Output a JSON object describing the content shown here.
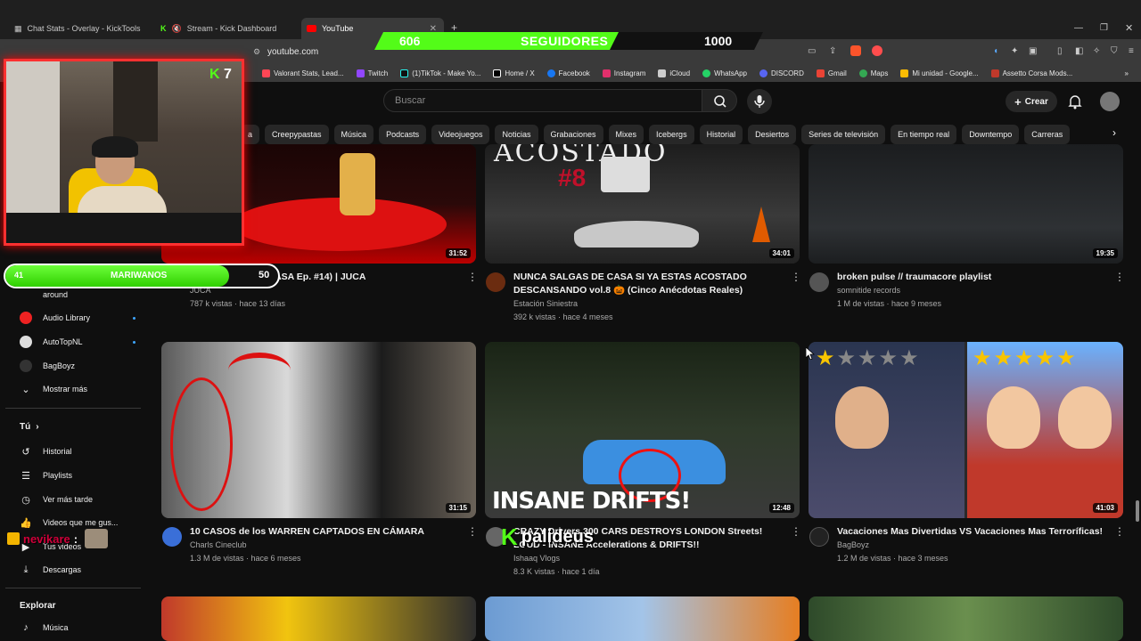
{
  "browser": {
    "tabs": [
      {
        "title": "Chat Stats - Overlay - KickTools",
        "active": false
      },
      {
        "title": "Stream - Kick Dashboard",
        "active": false
      },
      {
        "title": "YouTube",
        "active": true
      }
    ],
    "url": "youtube.com",
    "bookmarks": [
      "Valorant Stats, Lead...",
      "Twitch",
      "(1)TikTok - Make Yo...",
      "Home / X",
      "Facebook",
      "Instagram",
      "iCloud",
      "WhatsApp",
      "DISCORD",
      "Gmail",
      "Maps",
      "Mi unidad - Google...",
      "Assetto Corsa Mods..."
    ]
  },
  "youtube": {
    "search_placeholder": "Buscar",
    "create_label": "Crear",
    "chips": [
      "a",
      "Creepypastas",
      "Música",
      "Podcasts",
      "Videojuegos",
      "Noticias",
      "Grabaciones",
      "Mixes",
      "Icebergs",
      "Historial",
      "Desiertos",
      "Series de televisión",
      "En tiempo real",
      "Downtempo",
      "Carreras"
    ]
  },
  "sidebar": {
    "subscriptions": [
      {
        "label": "around",
        "dot": false
      },
      {
        "label": "Audio Library",
        "dot": true
      },
      {
        "label": "AutoTopNL",
        "dot": true
      },
      {
        "label": "BagBoyz",
        "dot": false
      }
    ],
    "show_more": "Mostrar más",
    "you_header": "Tú",
    "you_items": [
      "Historial",
      "Playlists",
      "Ver más tarde",
      "Videos que me gus...",
      "Tus videos",
      "Descargas"
    ],
    "explore_header": "Explorar",
    "explore_items": [
      "Música"
    ]
  },
  "videos_row1": [
    {
      "title": "...EGÓ A ...SA (JUCASA Ep. #14) | JUCA",
      "channel": "JUCA",
      "meta": "787 k vistas · hace 13 días",
      "duration": "31:52"
    },
    {
      "title": "NUNCA SALGAS DE CASA SI YA ESTAS ACOSTADO DESCANSANDO vol.8 🎃 (Cinco Anécdotas Reales)",
      "channel": "Estación Siniestra",
      "meta": "392 k vistas · hace 4 meses",
      "duration": "34:01",
      "thumb_text": "ACOSTADO",
      "thumb_num": "#8"
    },
    {
      "title": "broken pulse // traumacore playlist",
      "channel": "somnitide records",
      "meta": "1 M de vistas · hace 9 meses",
      "duration": "19:35"
    }
  ],
  "videos_row2": [
    {
      "title": "10 CASOS de los WARREN CAPTADOS EN CÁMARA",
      "channel": "Charls Cineclub",
      "meta": "1.3 M de vistas · hace 6 meses",
      "duration": "31:15"
    },
    {
      "title": "CRAZY Drivers 300 CARS DESTROYS LONDON Streets! LOUD - INSANE Accelerations & DRIFTS!!",
      "channel": "Ishaaq Vlogs",
      "meta": "8.3 K vistas · hace 1 día",
      "duration": "12:48",
      "thumb_text": "INSANE DRIFTS!"
    },
    {
      "title": "Vacaciones Mas Divertidas VS Vacaciones Mas Terroríficas!",
      "channel": "BagBoyz",
      "meta": "1.2 M de vistas · hace 3 meses",
      "duration": "41:03"
    }
  ],
  "overlay": {
    "followers_current": "606",
    "followers_label": "SEGUIDORES",
    "followers_goal": "1000",
    "followers_progress": 0.606,
    "kick_badge": "7",
    "goal_left": "41",
    "goal_label": "MARIWANOS",
    "goal_right": "50",
    "goal_progress": 0.82,
    "chat_user1": "nevikare",
    "chat_user2": "palideus"
  },
  "colors": {
    "kick_green": "#53fc18",
    "accent_red": "#ff3030",
    "yt_bg": "#0f0f0f",
    "link_blue": "#3ea6ff"
  }
}
